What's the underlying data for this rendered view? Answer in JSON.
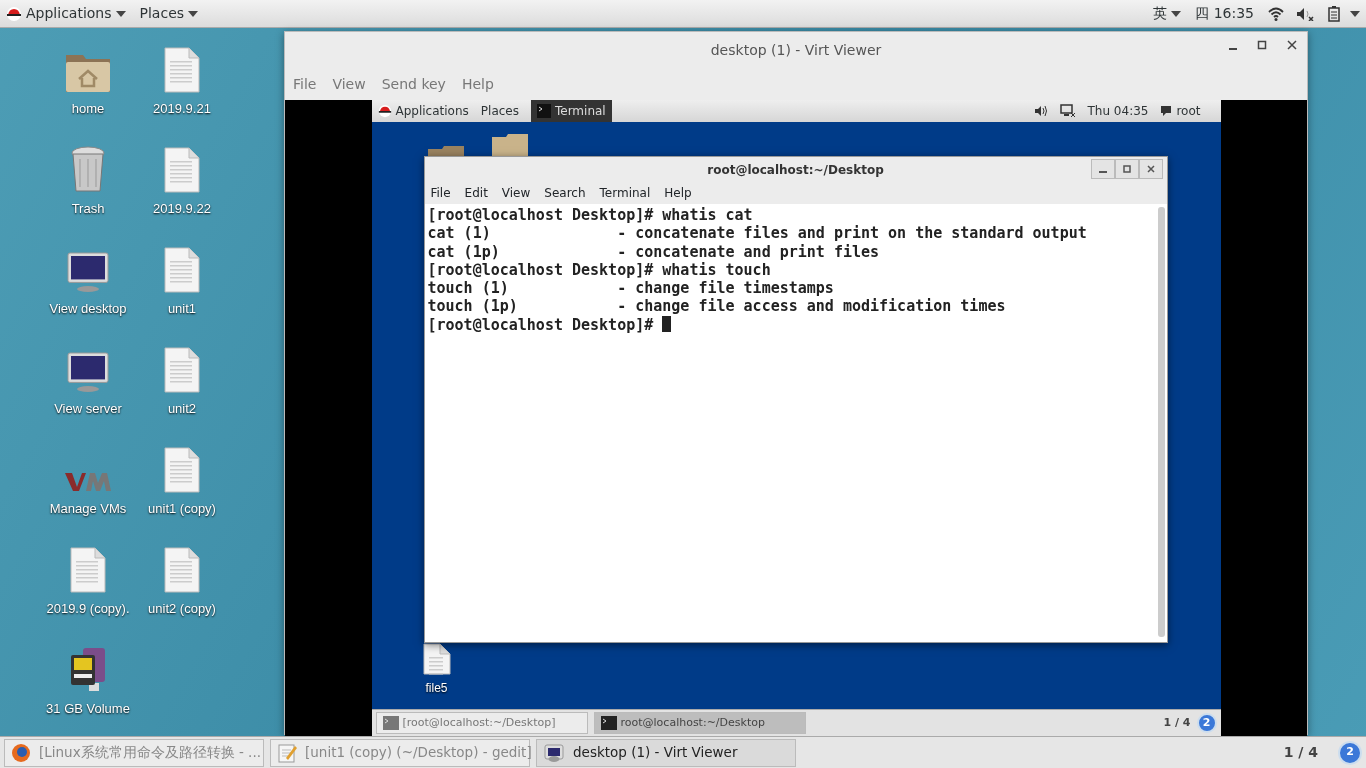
{
  "top_bar": {
    "menus": [
      {
        "label": "Applications"
      },
      {
        "label": "Places"
      }
    ],
    "input_method": "英",
    "clock": "四 16:35"
  },
  "desktop_icons": [
    {
      "label": "home",
      "kind": "home"
    },
    {
      "label": "2019.9.21",
      "kind": "file"
    },
    {
      "label": "Trash",
      "kind": "trash"
    },
    {
      "label": "2019.9.22",
      "kind": "file"
    },
    {
      "label": "View desktop",
      "kind": "monitor"
    },
    {
      "label": "unit1",
      "kind": "file"
    },
    {
      "label": "View server",
      "kind": "monitor"
    },
    {
      "label": "unit2",
      "kind": "file"
    },
    {
      "label": "Manage VMs",
      "kind": "vm"
    },
    {
      "label": "unit1 (copy)",
      "kind": "file"
    },
    {
      "label": "2019.9 (copy).",
      "kind": "file"
    },
    {
      "label": "unit2 (copy)",
      "kind": "file"
    },
    {
      "label": "31 GB Volume",
      "kind": "drive"
    }
  ],
  "viewer": {
    "title": "desktop (1) - Virt Viewer",
    "menu": [
      "File",
      "View",
      "Send key",
      "Help"
    ],
    "guest": {
      "top_bar": {
        "menus": [
          "Applications",
          "Places"
        ],
        "task": "Terminal",
        "clock": "Thu 04:35",
        "user": "root"
      },
      "desktop_icons": [
        {
          "label": "file5",
          "kind": "file"
        }
      ],
      "terminal": {
        "title": "root@localhost:~/Desktop",
        "menu": [
          "File",
          "Edit",
          "View",
          "Search",
          "Terminal",
          "Help"
        ],
        "lines": [
          "[root@localhost Desktop]# whatis cat",
          "cat (1)              - concatenate files and print on the standard output",
          "cat (1p)             - concatenate and print files",
          "[root@localhost Desktop]# whatis touch",
          "touch (1)            - change file timestamps",
          "touch (1p)           - change file access and modification times",
          "[root@localhost Desktop]# "
        ]
      },
      "taskbar": {
        "tasks": [
          {
            "label": "[root@localhost:~/Desktop]",
            "selected": false
          },
          {
            "label": "root@localhost:~/Desktop",
            "selected": true
          }
        ],
        "pager": "1 / 4",
        "badge": "2"
      }
    }
  },
  "taskbar": {
    "tasks": [
      {
        "label": "[Linux系统常用命令及路径转换 - ...",
        "kind": "browser",
        "selected": false
      },
      {
        "label": "[unit1 (copy) (~/Desktop) - gedit]",
        "kind": "editor",
        "selected": false
      },
      {
        "label": "desktop (1) - Virt Viewer",
        "kind": "viewer",
        "selected": true
      }
    ],
    "pager": "1 / 4",
    "badge": "2"
  }
}
